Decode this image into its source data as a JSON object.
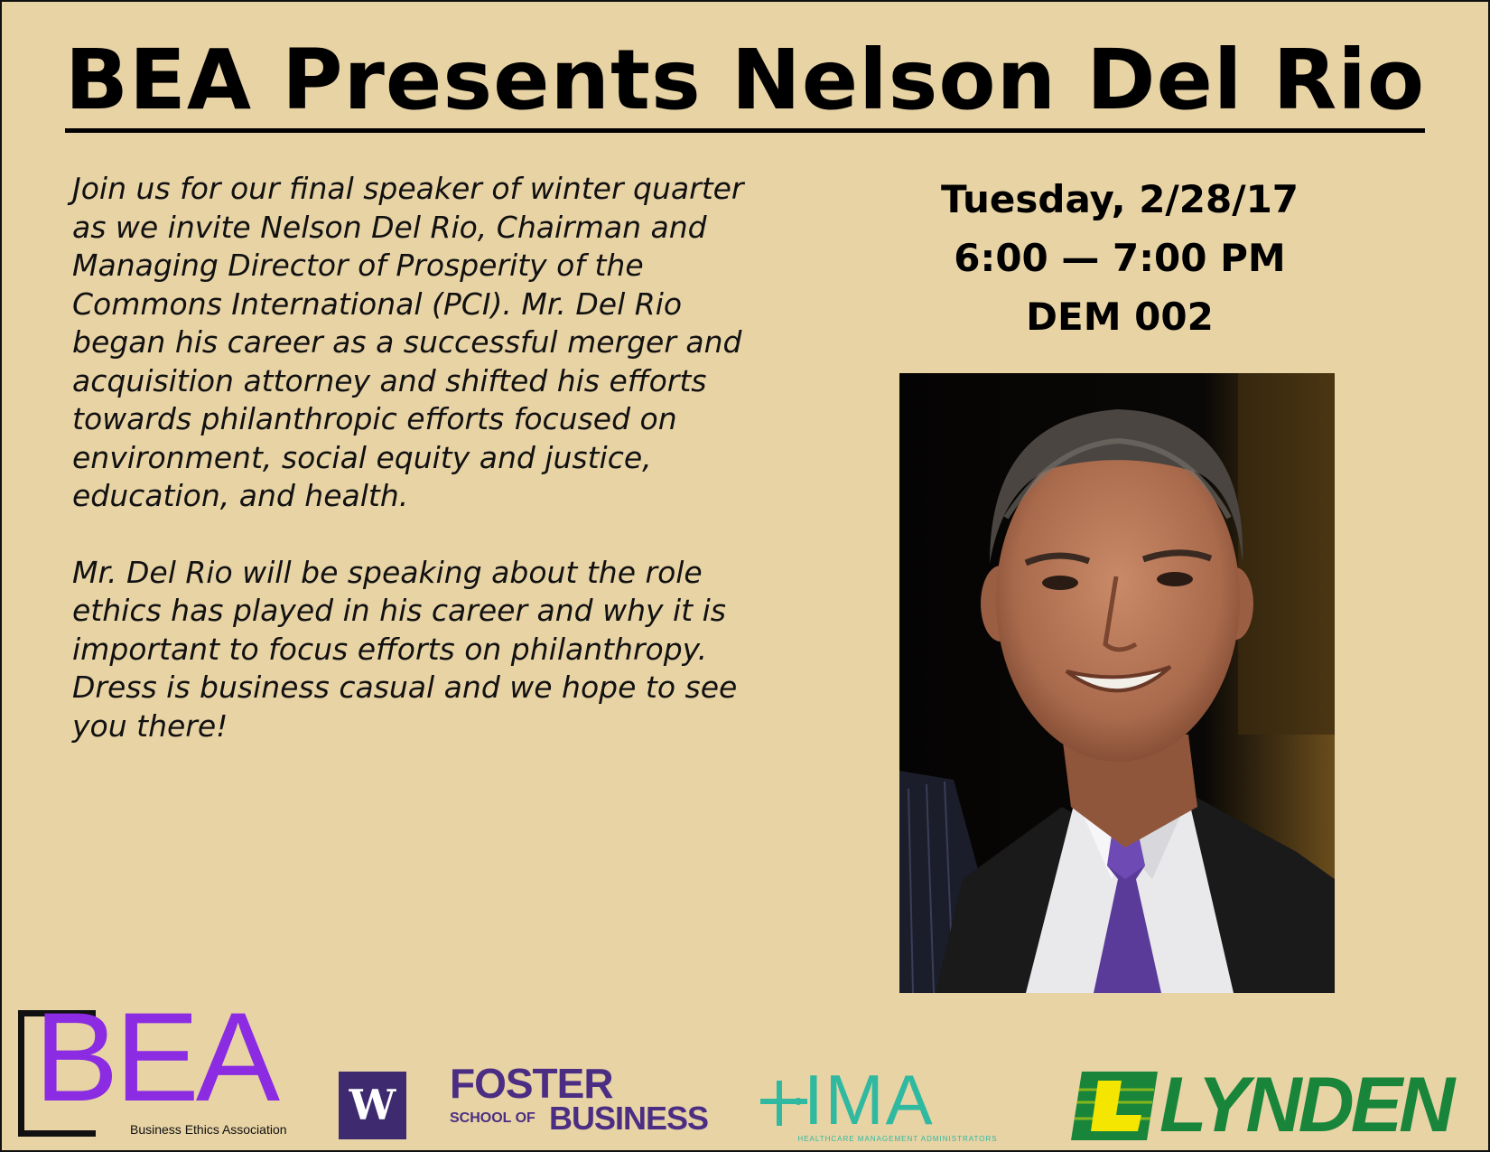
{
  "title": "BEA Presents Nelson Del Rio",
  "description": {
    "paragraph1": "Join us for our final speaker of winter quarter as we invite Nelson Del Rio, Chairman and Managing Director of Prosperity of the Commons International (PCI). Mr. Del Rio began his career as a successful merger and acquisition attorney and shifted his efforts towards philanthropic efforts focused on environment, social equity and justice, education, and health.",
    "paragraph2": "Mr. Del Rio will be speaking about the role ethics has played in his career and why it is important to focus efforts on philanthropy. Dress is business casual and we hope to see you there!"
  },
  "event": {
    "date": "Tuesday, 2/28/17",
    "time": "6:00 — 7:00 PM",
    "location": "DEM 002"
  },
  "logos": {
    "bea": {
      "letters": "BEA",
      "subtitle": "Business Ethics Association",
      "color": "#8b2be2"
    },
    "uw": {
      "letter": "W",
      "color": "#3e2a6e"
    },
    "foster": {
      "line1": "FOSTER",
      "line2a": "SCHOOL OF",
      "line2b": "BUSINESS",
      "color": "#4b2e83"
    },
    "hma": {
      "letters": "IMA",
      "subtitle": "HEALTHCARE MANAGEMENT ADMINISTRATORS",
      "color": "#2fb9a0"
    },
    "lynden": {
      "letters": "LYNDEN",
      "color": "#18853a"
    }
  },
  "colors": {
    "background": "#e8d3a5",
    "text": "#000000"
  }
}
